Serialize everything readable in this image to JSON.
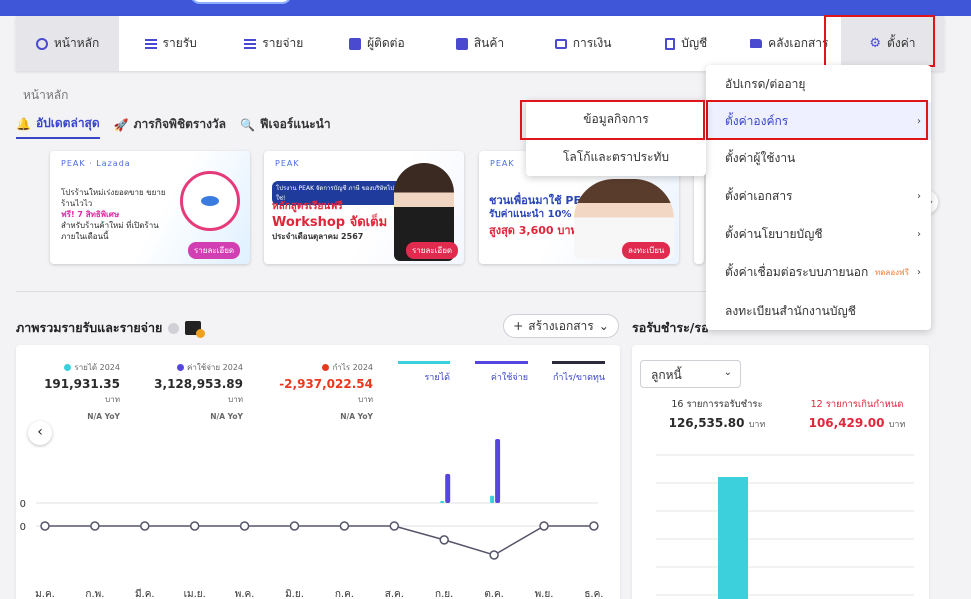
{
  "nav": {
    "items": [
      {
        "label": "หน้าหลัก",
        "icon": "home-icon"
      },
      {
        "label": "รายรับ",
        "icon": "income-icon"
      },
      {
        "label": "รายจ่าย",
        "icon": "expense-icon"
      },
      {
        "label": "ผู้ติดต่อ",
        "icon": "contacts-icon"
      },
      {
        "label": "สินค้า",
        "icon": "product-box-icon"
      },
      {
        "label": "การเงิน",
        "icon": "wallet-icon"
      },
      {
        "label": "บัญชี",
        "icon": "ledger-book-icon"
      },
      {
        "label": "คลังเอกสาร",
        "icon": "folder-icon"
      },
      {
        "label": "ตั้งค่า",
        "icon": "gear-icon"
      }
    ]
  },
  "breadcrumb": "หน้าหลัก",
  "subtabs": [
    {
      "label": "อัปเดตล่าสุด",
      "icon": "bell-icon"
    },
    {
      "label": "ภารกิจพิชิตรางวัล",
      "icon": "rocket-icon"
    },
    {
      "label": "ฟีเจอร์แนะนำ",
      "icon": "search-icon"
    }
  ],
  "banners": [
    {
      "logo": "PEAK · Lazada",
      "line1": "โปรร้านใหม่เร่งยอดขาย ขยายร้านไวไว",
      "line2": "ฟรี! 7 สิทธิพิเศษ",
      "line3": "สำหรับร้านค้าใหม่ ที่เปิดร้านภายในเดือนนี้",
      "button": "รายละเอียด"
    },
    {
      "logo": "PEAK",
      "header": "โปรงาน PEAK จัดการบัญชี ภาษี ของบริษัทไปใช่!",
      "line1": "หลักสูตรเรียนฟรี",
      "line2": "Workshop จัดเต็ม",
      "line3": "ประจำเดือนตุลาคม 2567",
      "button": "รายละเอียด"
    },
    {
      "logo": "PEAK",
      "line1": "ชวนเพื่อนมาใช้ PEAK",
      "line2": "รับค่าแนะนำ 10%",
      "line3": "สูงสุด 3,600 บาท*",
      "button": "ลงทะเบียน"
    }
  ],
  "overview": {
    "title": "ภาพรวมรายรับและรายจ่าย",
    "create_button": "สร้างเอกสาร",
    "stats": [
      {
        "label": "รายได้ 2024",
        "value": "191,931.35",
        "unit": "บาท",
        "yoy": "N/A YoY",
        "color": "#3ccfdc"
      },
      {
        "label": "ค่าใช้จ่าย 2024",
        "value": "3,128,953.89",
        "unit": "บาท",
        "yoy": "N/A YoY",
        "color": "#5646e0"
      },
      {
        "label": "กำไร 2024",
        "value": "-2,937,022.54",
        "unit": "บาท",
        "yoy": "N/A YoY",
        "color": "#e8391e"
      }
    ],
    "legend": [
      {
        "label": "รายได้",
        "color": "#3ccfdc"
      },
      {
        "label": "ค่าใช้จ่าย",
        "color": "#5646e0"
      },
      {
        "label": "กำไร/ขาดทุน",
        "color": "#2a2a3a"
      }
    ],
    "y_tick_labels": [
      "0",
      "0"
    ]
  },
  "chart_data": {
    "type": "bar",
    "categories": [
      "ม.ค.",
      "ก.พ.",
      "มี.ค.",
      "เม.ย.",
      "พ.ค.",
      "มิ.ย.",
      "ก.ค.",
      "ส.ค.",
      "ก.ย.",
      "ต.ค.",
      "พ.ย.",
      "ธ.ค."
    ],
    "series": [
      {
        "name": "รายได้",
        "values": [
          0,
          0,
          0,
          0,
          0,
          0,
          0,
          0,
          40000,
          150000,
          0,
          0
        ]
      },
      {
        "name": "ค่าใช้จ่าย",
        "values": [
          0,
          0,
          0,
          0,
          0,
          0,
          0,
          0,
          600000,
          1320000,
          0,
          0
        ]
      },
      {
        "name": "กำไร/ขาดทุน",
        "values": [
          0,
          0,
          0,
          0,
          0,
          0,
          0,
          0,
          -560000,
          -1170000,
          0,
          0
        ]
      }
    ],
    "xlabel": "",
    "ylabel": ""
  },
  "ar": {
    "title": "รอรับชำระ/รอ",
    "select_value": "ลูกหนี้",
    "left_label": "16 รายการรอรับชำระ",
    "left_value": "126,535.80",
    "right_label": "12 รายการเกินกำหนด",
    "right_value": "106,429.00",
    "unit": "บาท",
    "bar_color": "#3ccfdc"
  },
  "settings_menu": {
    "items": [
      {
        "label": "อัปเกรด/ต่ออายุ",
        "arrow": ""
      },
      {
        "label": "ตั้งค่าองค์กร",
        "arrow": "›"
      },
      {
        "label": "ตั้งค่าผู้ใช้งาน",
        "arrow": ""
      },
      {
        "label": "ตั้งค่าเอกสาร",
        "arrow": "›"
      },
      {
        "label": "ตั้งค่านโยบายบัญชี",
        "arrow": "›"
      },
      {
        "label": "ตั้งค่าเชื่อมต่อระบบภายนอก",
        "arrow": "›",
        "badge": "ทดลองฟรี"
      },
      {
        "label": "ลงทะเบียนสำนักงานบัญชี",
        "arrow": ""
      }
    ]
  },
  "submenu": {
    "items": [
      {
        "label": "ข้อมูลกิจการ"
      },
      {
        "label": "โลโก้และตราประทับ"
      }
    ]
  }
}
